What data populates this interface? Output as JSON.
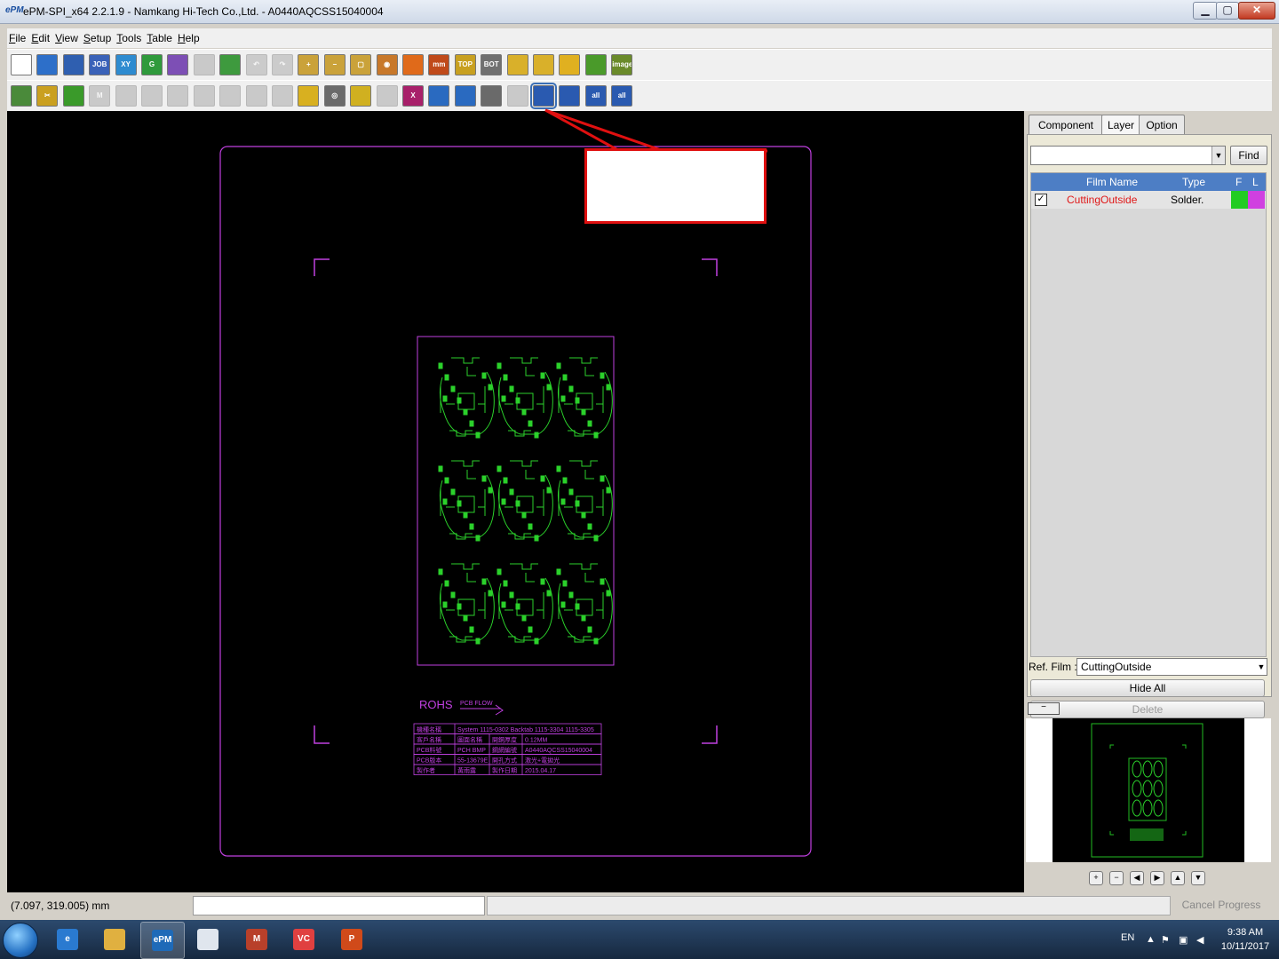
{
  "window": {
    "title": "ePM-SPI_x64 2.2.1.9 - Namkang Hi-Tech Co.,Ltd. - A0440AQCSS15040004",
    "app_icon": "epm-logo-icon",
    "buttons": {
      "minimize": "▁",
      "maximize": "▢",
      "close": "✕"
    }
  },
  "menu": [
    "File",
    "Edit",
    "View",
    "Setup",
    "Tools",
    "Table",
    "Help"
  ],
  "toolbar1": [
    {
      "name": "new-file-icon",
      "label": "",
      "color": "#ffffff"
    },
    {
      "name": "open-folder-icon",
      "label": "",
      "color": "#2d6fc9"
    },
    {
      "name": "save-icon",
      "label": "",
      "color": "#2f5fb0"
    },
    {
      "name": "job-icon",
      "label": "JOB",
      "color": "#3a62b8"
    },
    {
      "name": "xy-icon",
      "label": "XY",
      "color": "#2e8bd0"
    },
    {
      "name": "g-icon",
      "label": "G",
      "color": "#2f9a3c"
    },
    {
      "name": "export-icon",
      "label": "",
      "color": "#7d4fb5"
    },
    {
      "name": "grid-icon",
      "label": "",
      "color": "#9a9a9a",
      "disabled": true
    },
    {
      "name": "film-icon",
      "label": "",
      "color": "#3e9a3e"
    },
    {
      "name": "undo-icon",
      "label": "↶",
      "color": "#a0a0a0",
      "disabled": true
    },
    {
      "name": "redo-icon",
      "label": "↷",
      "color": "#a0a0a0",
      "disabled": true
    },
    {
      "name": "zoom-in-icon",
      "label": "+",
      "color": "#caa23a"
    },
    {
      "name": "zoom-out-icon",
      "label": "−",
      "color": "#caa23a"
    },
    {
      "name": "zoom-window-icon",
      "label": "▢",
      "color": "#caa23a"
    },
    {
      "name": "zoom-fit-icon",
      "label": "◉",
      "color": "#c8782a"
    },
    {
      "name": "layout-icon",
      "label": "",
      "color": "#e06a1a"
    },
    {
      "name": "measure-mm-icon",
      "label": "mm",
      "color": "#c04a1a"
    },
    {
      "name": "top-view-icon",
      "label": "TOP",
      "color": "#c8a020"
    },
    {
      "name": "bottom-view-icon",
      "label": "BOT",
      "color": "#707070"
    },
    {
      "name": "rotate-icon",
      "label": "",
      "color": "#d9b02a"
    },
    {
      "name": "component-icon",
      "label": "",
      "color": "#d9b02a"
    },
    {
      "name": "pad-icon",
      "label": "",
      "color": "#e0b020"
    },
    {
      "name": "align-icon",
      "label": "",
      "color": "#4a9a2a"
    },
    {
      "name": "image-icon",
      "label": "image",
      "color": "#6a8a2a"
    }
  ],
  "toolbar2": [
    {
      "name": "pencil-icon",
      "label": "",
      "color": "#4a8a3a"
    },
    {
      "name": "cut-icon",
      "label": "✂",
      "color": "#caa020"
    },
    {
      "name": "chip-icon",
      "label": "",
      "color": "#3a9a2a"
    },
    {
      "name": "mark-icon",
      "label": "M",
      "color": "#9a9a9a",
      "disabled": true
    },
    {
      "name": "pad-gray-icon",
      "label": "",
      "color": "#9a9a9a",
      "disabled": true
    },
    {
      "name": "array-icon",
      "label": "",
      "color": "#9a9a9a",
      "disabled": true
    },
    {
      "name": "array2-icon",
      "label": "",
      "color": "#9a9a9a",
      "disabled": true
    },
    {
      "name": "group-icon",
      "label": "",
      "color": "#9a9a9a",
      "disabled": true
    },
    {
      "name": "gear-gray-icon",
      "label": "",
      "color": "#9a9a9a",
      "disabled": true
    },
    {
      "name": "settings-gray-icon",
      "label": "",
      "color": "#9a9a9a",
      "disabled": true
    },
    {
      "name": "grid2-icon",
      "label": "",
      "color": "#9a9a9a",
      "disabled": true
    },
    {
      "name": "flip-icon",
      "label": "",
      "color": "#d8b020"
    },
    {
      "name": "target-icon",
      "label": "◎",
      "color": "#6a6a6a"
    },
    {
      "name": "globe-icon",
      "label": "",
      "color": "#d0b020"
    },
    {
      "name": "stack-icon",
      "label": "",
      "color": "#9a9a9a",
      "disabled": true
    },
    {
      "name": "delete-x-icon",
      "label": "X",
      "color": "#a8206a"
    },
    {
      "name": "merge-icon",
      "label": "",
      "color": "#2a6ac0"
    },
    {
      "name": "transfer-icon",
      "label": "",
      "color": "#2a6ac0"
    },
    {
      "name": "columns-icon",
      "label": "",
      "color": "#6a6a6a"
    },
    {
      "name": "split-icon",
      "label": "",
      "color": "#9a9a9a",
      "disabled": true
    },
    {
      "name": "cad-icon",
      "label": "",
      "color": "#2a5ab0",
      "selected": true
    },
    {
      "name": "cad2-icon",
      "label": "",
      "color": "#2a5ab0"
    },
    {
      "name": "cad-all-icon",
      "label": "all",
      "color": "#2a5ab0"
    },
    {
      "name": "cad-all2-icon",
      "label": "all",
      "color": "#2a5ab0"
    }
  ],
  "right_panel": {
    "tabs": [
      "Component",
      "Layer",
      "Option"
    ],
    "active_tab": "Layer",
    "find_label": "Find",
    "table_headers": {
      "film_name": "Film Name",
      "type": "Type",
      "f": "F",
      "l": "L"
    },
    "rows": [
      {
        "checked": "✓",
        "film_name": "CuttingOutside",
        "type": "Solder.",
        "f_color": "#22cc22",
        "l_color": "#d040e0"
      }
    ],
    "ref_film_label": "Ref. Film :",
    "ref_film_value": "CuttingOutside",
    "hide_all_label": "Hide All",
    "delete_label": "Delete",
    "collapse_label": "−",
    "nav_buttons": [
      "+",
      "−",
      "◀",
      "▶",
      "▲",
      "▼"
    ]
  },
  "board": {
    "rohs": "ROHS",
    "pcb_flow": "PCB FLOW",
    "table_rows": [
      [
        "機種名稱",
        "System 1115-0302 Backtab 1115-3304 1115-3305"
      ],
      [
        "客戶名稱",
        "圖面名稱",
        "開鋼厚度",
        "0.12MM"
      ],
      [
        "PCB料號",
        "PCH BMP",
        "鋼網編號",
        "A0440AQCSS15040004"
      ],
      [
        "PCB版本",
        "55-13679E",
        "開孔方式",
        "激光+電拋光"
      ],
      [
        "製作者",
        "黃雨露",
        "製作日期",
        "2015.04.17"
      ]
    ]
  },
  "status": {
    "coords": "(7.097, 319.005) mm",
    "cancel_progress": "Cancel Progress"
  },
  "taskbar": {
    "apps": [
      {
        "name": "ie-icon",
        "label": "e",
        "color": "#2a7ad0"
      },
      {
        "name": "explorer-folder-icon",
        "label": "",
        "color": "#e0b040"
      },
      {
        "name": "epm-app-icon",
        "label": "ePM",
        "color": "#1e6ab8",
        "active": true
      },
      {
        "name": "window-app-icon",
        "label": "",
        "color": "#e0e6ee"
      },
      {
        "name": "mcafee-icon",
        "label": "M",
        "color": "#b8402a"
      },
      {
        "name": "vc-icon",
        "label": "VC",
        "color": "#e04040"
      },
      {
        "name": "powerpoint-icon",
        "label": "P",
        "color": "#d04a1a"
      }
    ],
    "lang": "EN",
    "time": "9:38 AM",
    "date": "10/11/2017"
  }
}
